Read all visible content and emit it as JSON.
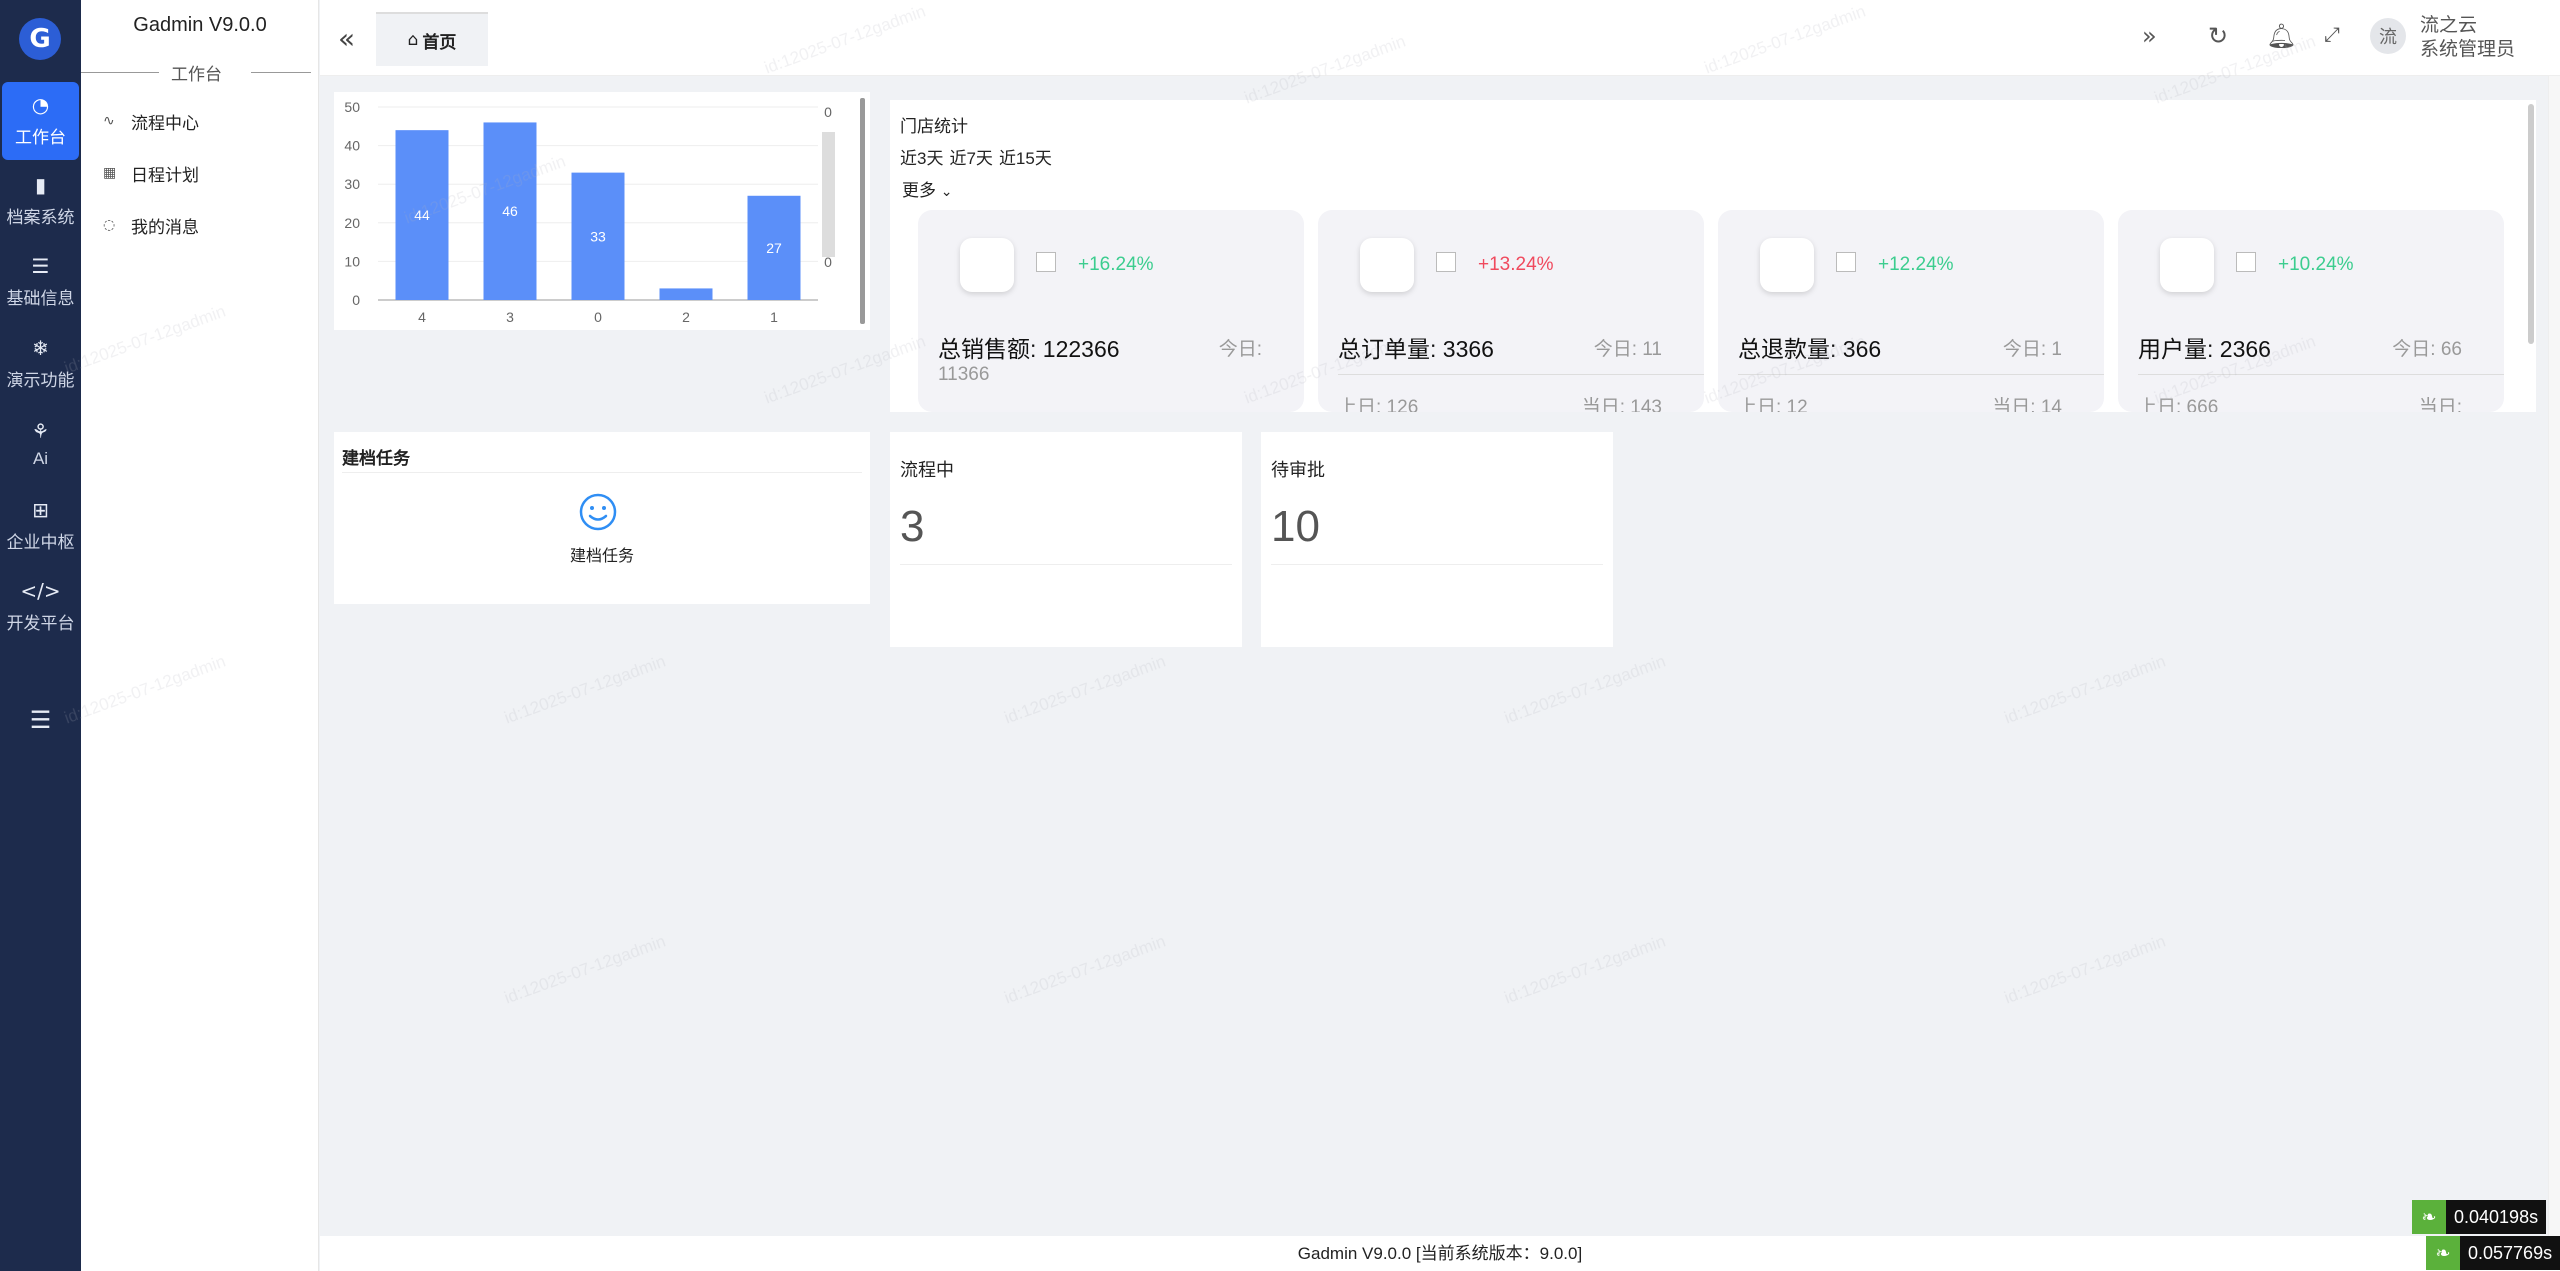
{
  "app": {
    "title": "Gadmin V9.0.0",
    "logo_letter": "G"
  },
  "rail": {
    "items": [
      {
        "label": "工作台",
        "icon": "dashboard-icon",
        "glyph": "◔",
        "active": true
      },
      {
        "label": "档案系统",
        "icon": "bar-chart-icon",
        "glyph": "▮"
      },
      {
        "label": "基础信息",
        "icon": "list-icon",
        "glyph": "☰"
      },
      {
        "label": "演示功能",
        "icon": "snowflake-icon",
        "glyph": "❄"
      },
      {
        "label": "Ai",
        "icon": "ai-icon",
        "glyph": "⚘"
      },
      {
        "label": "企业中枢",
        "icon": "apps-icon",
        "glyph": "⊞"
      },
      {
        "label": "开发平台",
        "icon": "code-icon",
        "glyph": "</>"
      }
    ],
    "collapse_icon": "menu-fold-icon"
  },
  "submenu": {
    "group": "工作台",
    "items": [
      {
        "label": "流程中心",
        "icon": "pulse-icon",
        "glyph": "∿"
      },
      {
        "label": "日程计划",
        "icon": "calendar-icon",
        "glyph": "▦"
      },
      {
        "label": "我的消息",
        "icon": "message-icon",
        "glyph": "◌"
      }
    ]
  },
  "header": {
    "tab_label": "首页",
    "user_avatar": "流",
    "user_name": "流之云",
    "user_role": "系统管理员"
  },
  "chart_data": {
    "type": "bar",
    "categories": [
      "4",
      "3",
      "0",
      "2",
      "1"
    ],
    "values": [
      44,
      46,
      33,
      3,
      27
    ],
    "ylim": [
      0,
      50
    ],
    "yticks": [
      0,
      10,
      20,
      30,
      40,
      50
    ],
    "right_axis_ticks": [
      "0",
      "0"
    ],
    "color": "#5b8ff9",
    "grid": true,
    "data_labels": true
  },
  "store": {
    "title": "门店统计",
    "ranges": [
      "近3天",
      "近7天",
      "近15天"
    ],
    "more": "更多",
    "stats": [
      {
        "pct": "+16.24%",
        "pct_color": "#3ccd8f",
        "main": "总销售额: 122366",
        "today": "今日:",
        "today_value": "11366",
        "prev": "",
        "cur": ""
      },
      {
        "pct": "+13.24%",
        "pct_color": "#f04a5e",
        "main": "总订单量: 3366",
        "today": "今日: 11",
        "today_value": "",
        "prev": "上日: 126",
        "cur": "当日: 143"
      },
      {
        "pct": "+12.24%",
        "pct_color": "#3ccd8f",
        "main": "总退款量: 366",
        "today": "今日: 1",
        "today_value": "",
        "prev": "上日: 12",
        "cur": "当日: 14"
      },
      {
        "pct": "+10.24%",
        "pct_color": "#3ccd8f",
        "main": "用户量: 2366",
        "today": "今日: 66",
        "today_value": "",
        "prev": "上日: 666",
        "cur": "当日:"
      }
    ]
  },
  "task": {
    "title": "建档任务",
    "label": "建档任务"
  },
  "counts": [
    {
      "title": "流程中",
      "value": "3"
    },
    {
      "title": "待审批",
      "value": "10"
    }
  ],
  "footer": {
    "text": "Gadmin V9.0.0 [当前系统版本：9.0.0]"
  },
  "perf": [
    "0.040198s",
    "0.057769s"
  ],
  "watermark": "id:12025-07-12gadmin"
}
